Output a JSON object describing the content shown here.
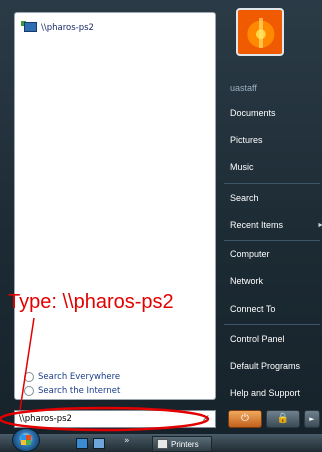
{
  "left_pane": {
    "result": {
      "label": "\\\\pharos-ps2",
      "icon": "network-printer-icon"
    },
    "search_links": [
      {
        "label": "Search Everywhere",
        "icon": "search-icon"
      },
      {
        "label": "Search the Internet",
        "icon": "search-icon"
      }
    ],
    "search_box": {
      "value": "\\\\pharos-ps2",
      "clear": "×"
    }
  },
  "right_pane": {
    "user": "uastaff",
    "items": [
      {
        "label": "Documents"
      },
      {
        "label": "Pictures"
      },
      {
        "label": "Music"
      },
      {
        "label": "Search"
      },
      {
        "label": "Recent Items",
        "arrow": "►"
      },
      {
        "label": "Computer"
      },
      {
        "label": "Network"
      },
      {
        "label": "Connect To"
      },
      {
        "label": "Control Panel"
      },
      {
        "label": "Default Programs"
      },
      {
        "label": "Help and Support"
      }
    ],
    "buttons": {
      "power": "⏻",
      "lock": "🔒",
      "more": "►"
    }
  },
  "taskbar": {
    "chevron": "»",
    "task_label": "Printers"
  },
  "annotation": {
    "text": "Type: \\\\pharos-ps2",
    "color": "#e30000"
  }
}
